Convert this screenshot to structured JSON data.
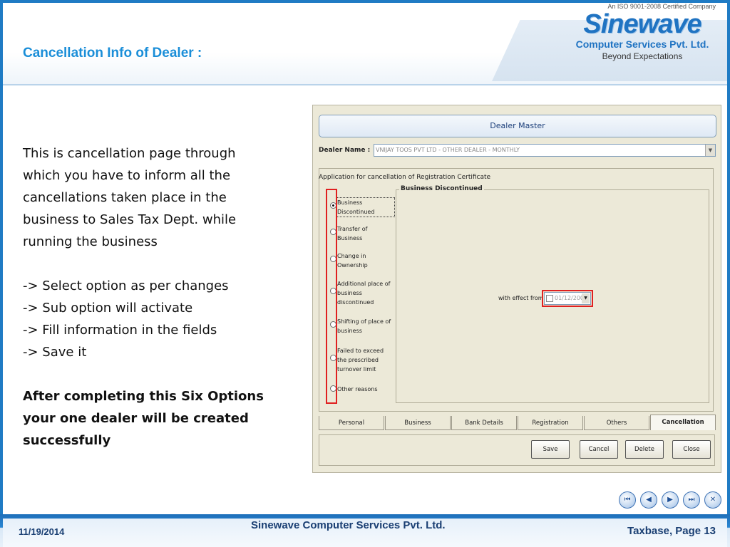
{
  "header": {
    "title": "Cancellation Info of Dealer :",
    "logo": {
      "certification": "An ISO 9001-2008 Certified Company",
      "brand": "Sinewave",
      "company": "Computer Services Pvt. Ltd.",
      "tagline": "Beyond Expectations"
    }
  },
  "body": {
    "intro": [
      "This is cancellation page through",
      "which you have to inform all the",
      "cancellations taken place in the",
      "business to Sales Tax Dept. while",
      "running the business"
    ],
    "steps": [
      "-> Select option as per changes",
      "-> Sub option will activate",
      "-> Fill information in the fields",
      "-> Save it"
    ],
    "conclusion": [
      "After completing this Six Options",
      "your one dealer will be created",
      "successfully"
    ]
  },
  "app": {
    "title": "Dealer Master",
    "dealer_label": "Dealer Name :",
    "dealer_value": "VNIJAY TOOS PVT LTD - OTHER DEALER -  MONTHLY",
    "group_caption": "Application for cancellation of Registration Certificate",
    "options": [
      {
        "label": "Business Discontinued",
        "selected": true
      },
      {
        "label": "Transfer of Business",
        "selected": false
      },
      {
        "label": "Change in Ownership",
        "selected": false
      },
      {
        "label": "Additional place of business discontinued",
        "selected": false
      },
      {
        "label": "Shifting of place of business",
        "selected": false
      },
      {
        "label": "Failed to exceed the prescribed turnover limit",
        "selected": false
      },
      {
        "label": "Other reasons",
        "selected": false
      }
    ],
    "sub_caption": "Business Discontinued",
    "effect_label": "with effect from :",
    "effect_date": "01/12/2008",
    "tabs": [
      "Personal",
      "Business",
      "Bank Details",
      "Registration",
      "Others",
      "Cancellation"
    ],
    "active_tab": "Cancellation",
    "buttons": {
      "save": "Save",
      "cancel": "Cancel",
      "delete": "Delete",
      "close": "Close"
    }
  },
  "nav": {
    "first": "⏮",
    "prev": "◀",
    "next": "▶",
    "last": "⏭",
    "close": "✕"
  },
  "footer": {
    "date": "11/19/2014",
    "company": "Sinewave Computer Services Pvt. Ltd.",
    "page": "Taxbase, Page 13"
  }
}
